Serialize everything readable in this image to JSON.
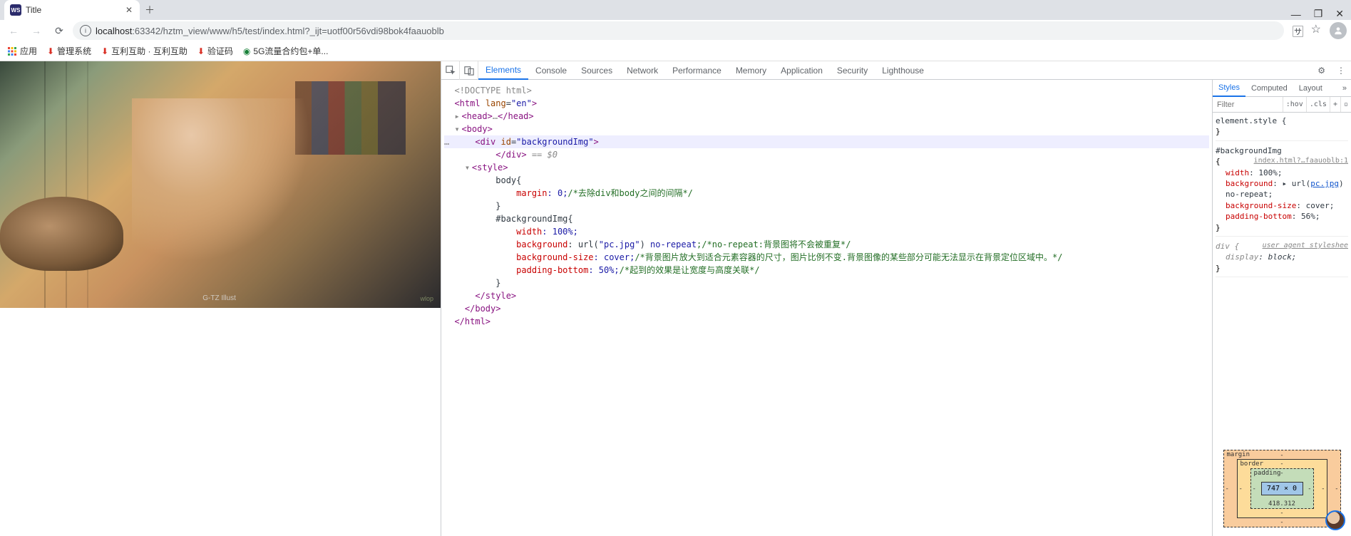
{
  "browser": {
    "tab_title": "Title",
    "favicon_text": "WS",
    "url_host": "localhost",
    "url_port_path": ":63342/hztm_view/www/h5/test/index.html?_ijt=uotf00r56vdi98bok4faauoblb",
    "bookmarks": {
      "apps": "应用",
      "bk1": "管理系统",
      "bk2": "互利互助 · 互利互助",
      "bk3": "验证码",
      "bk4": "5G流量合约包+单..."
    }
  },
  "page": {
    "artist_sig": "G-TZ Illust",
    "corner_logo": "wlop"
  },
  "devtools": {
    "tabs": {
      "elements": "Elements",
      "console": "Console",
      "sources": "Sources",
      "network": "Network",
      "performance": "Performance",
      "memory": "Memory",
      "application": "Application",
      "security": "Security",
      "lighthouse": "Lighthouse"
    },
    "code": {
      "l1": "<!DOCTYPE html>",
      "l2_open": "<html ",
      "l2_attr": "lang",
      "l2_val": "\"en\"",
      "l2_close": ">",
      "l3_head_open": "<head>",
      "l3_head_ellipsis": "…",
      "l3_head_close": "</head>",
      "l4_body": "<body>",
      "l5_open": "<div ",
      "l5_attr": "id",
      "l5_val": "\"backgroundImg\"",
      "l5_close": ">",
      "l6_divclose": "</div>",
      "l6_eq0": " == $0",
      "l7_style": "<style>",
      "l8_sel": "body{",
      "l9_prop": "margin",
      "l9_val": ": 0;",
      "l9_comment": "/*去除div和body之间的间隔*/",
      "l10_close": "}",
      "l11_sel": "#backgroundImg{",
      "l12_prop": "width",
      "l12_val": ": 100%;",
      "l13_prop": "background",
      "l13_val1": ": url(",
      "l13_url": "\"pc.jpg\"",
      "l13_val2": ") ",
      "l13_norep": "no-repeat",
      "l13_comment": ";/*no-repeat:背景图将不会被重复*/",
      "l14_prop": "background-size",
      "l14_val": ": cover;",
      "l14_comment": "/*背景图片放大到适合元素容器的尺寸，图片比例不变.背景图像的某些部分可能无法显示在背景定位区域中。*/",
      "l15_prop": "padding-bottom",
      "l15_val": ": 50%;",
      "l15_comment": "/*起到的效果是让宽度与高度关联*/",
      "l16_close": "}",
      "l17_styleclose": "</style>",
      "l18_bodyclose": "</body>",
      "l19_htmlclose": "</html>"
    },
    "styles": {
      "tabs": {
        "styles": "Styles",
        "computed": "Computed",
        "layout": "Layout"
      },
      "filter_ph": "Filter",
      "btn_hov": ":hov",
      "btn_cls": ".cls",
      "rule1_sel": "element.style {",
      "rule1_close": "}",
      "rule2_sel": "#backgroundImg",
      "rule2_link": "index.html?…faauoblb:1",
      "rule2_open": "{",
      "rule2_p1k": "width",
      "rule2_p1v": ": 100%;",
      "rule2_p2k": "background",
      "rule2_p2v1": ": ▸ url(",
      "rule2_p2url": "pc.jpg",
      "rule2_p2v2": ") no-repeat;",
      "rule2_p3k": "background-size",
      "rule2_p3v": ": cover;",
      "rule2_p4k": "padding-bottom",
      "rule2_p4v": ": 56%;",
      "rule2_close": "}",
      "rule3_sel": "div {",
      "rule3_ua": "user agent styleshee",
      "rule3_p1k": "display",
      "rule3_p1v": ": block;",
      "rule3_close": "}"
    },
    "boxmodel": {
      "margin_label": "margin",
      "border_label": "border",
      "padding_label": "padding",
      "content": "747 × 0",
      "padding_bottom": "418.312",
      "dash": "-"
    }
  }
}
